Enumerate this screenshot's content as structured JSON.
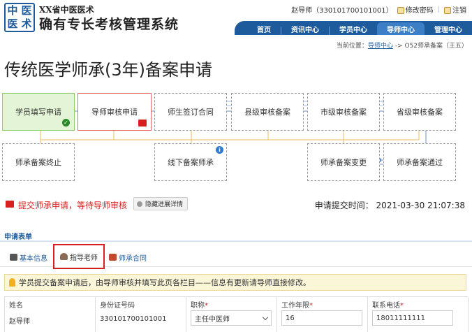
{
  "header": {
    "logo_chars": [
      "中",
      "医",
      "医",
      "术"
    ],
    "title_line1": "XX省中医医术",
    "title_line2": "确有专长考核管理系统",
    "user": "赵导师（330101700101001）",
    "change_password": "修改密码",
    "logout": "注销"
  },
  "nav": {
    "items": [
      "首页",
      "资讯中心",
      "学员中心",
      "导师中心",
      "管理中心"
    ],
    "active": "导师中心"
  },
  "breadcrumb": {
    "prefix": "当前位置：",
    "link": "导师中心",
    "rest": " -> O52师承备案（王五）"
  },
  "page_title": "传统医学师承(3年)备案申请",
  "flow": {
    "nodes": [
      {
        "id": "student-fill",
        "label": "学员填写申请",
        "state": "done"
      },
      {
        "id": "mentor-review",
        "label": "导师审核申请",
        "state": "current"
      },
      {
        "id": "sign-contract",
        "label": "师生签订合同",
        "state": "pending"
      },
      {
        "id": "county-record",
        "label": "县级审核备案",
        "state": "pending"
      },
      {
        "id": "city-record",
        "label": "市级审核备案",
        "state": "pending"
      },
      {
        "id": "province-record",
        "label": "省级审核备案",
        "state": "pending"
      },
      {
        "id": "terminate",
        "label": "师承备案终止",
        "state": "pending"
      },
      {
        "id": "offline-record",
        "label": "线下备案师承",
        "state": "pending"
      },
      {
        "id": "record-change",
        "label": "师承备案变更",
        "state": "pending"
      },
      {
        "id": "record-pass",
        "label": "师承备案通过",
        "state": "pending"
      }
    ]
  },
  "status": {
    "text": "提交师承申请，等待导师审核",
    "hide_button": "隐藏进展详情",
    "submit_time_label": "申请提交时间：",
    "submit_time": "2021-03-30 21:07:38"
  },
  "form": {
    "section_title": "申请表单",
    "tabs": [
      {
        "label": "基本信息",
        "icon": "id-card-icon"
      },
      {
        "label": "指导老师",
        "icon": "teacher-icon",
        "active": true
      },
      {
        "label": "师承合同",
        "icon": "contract-icon"
      }
    ],
    "notice": "学员提交备案申请后，由导师审核并填写此页各栏目——信息有更新请导师直接修改。",
    "fields": {
      "name": {
        "label": "姓名",
        "value": "赵导师"
      },
      "id_number": {
        "label": "身份证号码",
        "value": "330101700101001"
      },
      "title": {
        "label": "职称",
        "value": "主任中医师"
      },
      "work_years": {
        "label": "工作年限",
        "value": "16"
      },
      "phone": {
        "label": "联系电话",
        "value": "18011111111"
      }
    }
  },
  "colors": {
    "primary": "#1d5b9c",
    "done": "#e3f5d6",
    "alert": "#d82020"
  }
}
